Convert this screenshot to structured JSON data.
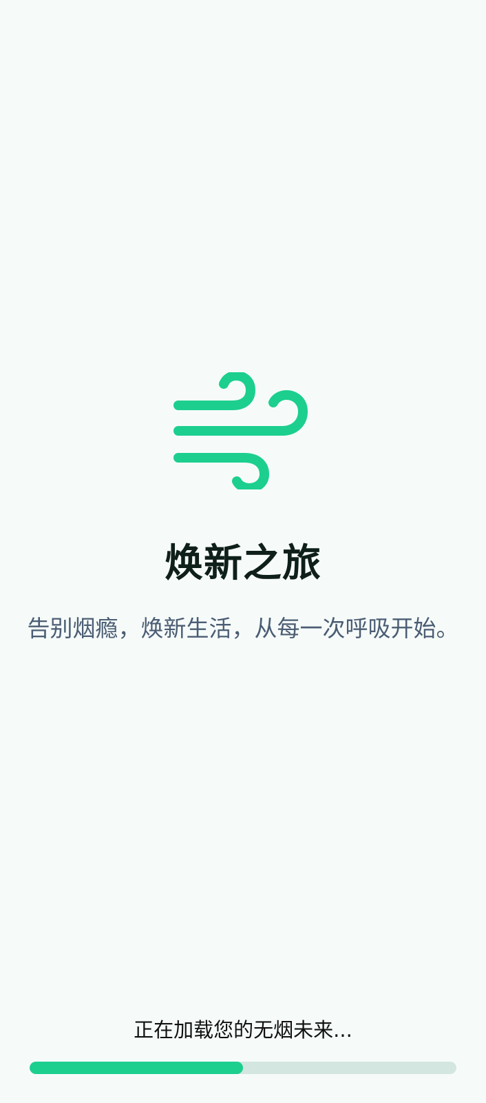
{
  "splash": {
    "logo_icon": "wind-icon",
    "title": "焕新之旅",
    "subtitle": "告别烟瘾，焕新生活，从每一次呼吸开始。"
  },
  "loading": {
    "text": "正在加载您的无烟未来...",
    "progress_percent": 50
  },
  "colors": {
    "accent": "#1ccf8e",
    "track": "#d3e6e0",
    "background": "#f6fbfa",
    "title": "#0f1f1a",
    "subtitle": "#4b5d73"
  }
}
